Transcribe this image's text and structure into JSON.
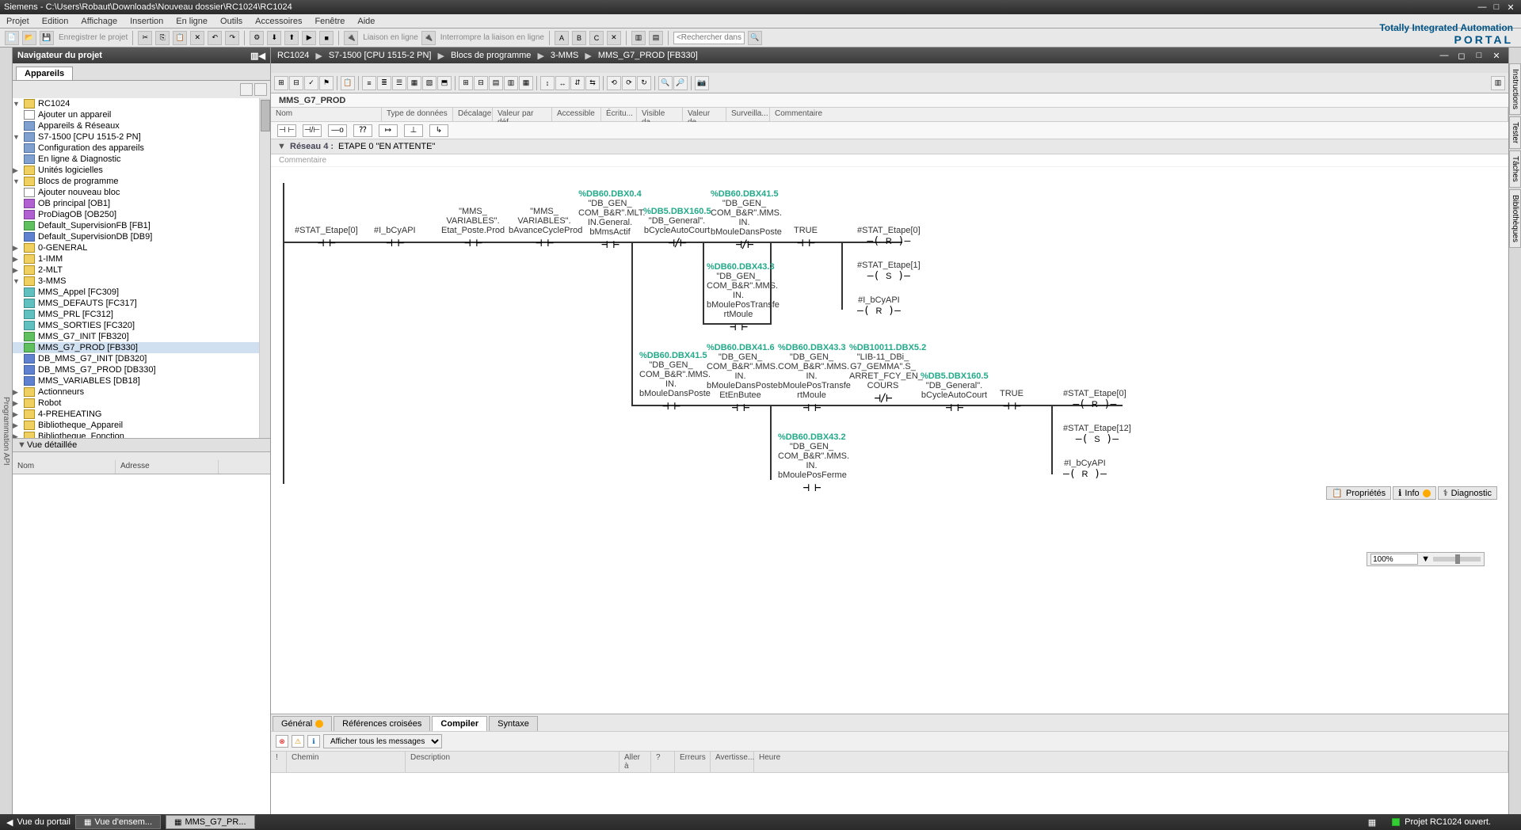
{
  "title": "Siemens  -  C:\\Users\\Robaut\\Downloads\\Nouveau dossier\\RC1024\\RC1024",
  "menus": [
    "Projet",
    "Edition",
    "Affichage",
    "Insertion",
    "En ligne",
    "Outils",
    "Accessoires",
    "Fenêtre",
    "Aide"
  ],
  "brand": {
    "line1": "Totally Integrated Automation",
    "line2": "PORTAL"
  },
  "toolbar": {
    "save": "Enregistrer le projet",
    "online": "Liaison en ligne",
    "offline": "Interrompre la liaison en ligne",
    "search_ph": "<Rechercher dans le"
  },
  "nav": {
    "title": "Navigateur du projet",
    "tab": "Appareils",
    "tree": [
      {
        "l": 0,
        "exp": "▼",
        "ic": "prj",
        "t": "RC1024"
      },
      {
        "l": 1,
        "exp": "",
        "ic": "add",
        "t": "Ajouter un appareil"
      },
      {
        "l": 1,
        "exp": "",
        "ic": "dev",
        "t": "Appareils & Réseaux"
      },
      {
        "l": 1,
        "exp": "▼",
        "ic": "dev",
        "t": "S7-1500 [CPU 1515-2 PN]"
      },
      {
        "l": 2,
        "exp": "",
        "ic": "dev",
        "t": "Configuration des appareils"
      },
      {
        "l": 2,
        "exp": "",
        "ic": "dev",
        "t": "En ligne & Diagnostic"
      },
      {
        "l": 2,
        "exp": "▶",
        "ic": "fld",
        "t": "Unités logicielles"
      },
      {
        "l": 2,
        "exp": "▼",
        "ic": "fld",
        "t": "Blocs de programme"
      },
      {
        "l": 3,
        "exp": "",
        "ic": "add",
        "t": "Ajouter nouveau bloc"
      },
      {
        "l": 3,
        "exp": "",
        "ic": "ob",
        "t": "OB principal [OB1]"
      },
      {
        "l": 3,
        "exp": "",
        "ic": "ob",
        "t": "ProDiagOB [OB250]"
      },
      {
        "l": 3,
        "exp": "",
        "ic": "fb",
        "t": "Default_SupervisionFB [FB1]"
      },
      {
        "l": 3,
        "exp": "",
        "ic": "db",
        "t": "Default_SupervisionDB [DB9]"
      },
      {
        "l": 3,
        "exp": "▶",
        "ic": "fld",
        "t": "0-GENERAL"
      },
      {
        "l": 3,
        "exp": "▶",
        "ic": "fld",
        "t": "1-IMM"
      },
      {
        "l": 3,
        "exp": "▶",
        "ic": "fld",
        "t": "2-MLT"
      },
      {
        "l": 3,
        "exp": "▼",
        "ic": "fld",
        "t": "3-MMS"
      },
      {
        "l": 4,
        "exp": "",
        "ic": "fc",
        "t": "MMS_Appel [FC309]"
      },
      {
        "l": 4,
        "exp": "",
        "ic": "fc",
        "t": "MMS_DEFAUTS [FC317]"
      },
      {
        "l": 4,
        "exp": "",
        "ic": "fc",
        "t": "MMS_PRL [FC312]"
      },
      {
        "l": 4,
        "exp": "",
        "ic": "fc",
        "t": "MMS_SORTIES [FC320]"
      },
      {
        "l": 4,
        "exp": "",
        "ic": "fb",
        "t": "MMS_G7_INIT [FB320]"
      },
      {
        "l": 4,
        "exp": "",
        "ic": "fb",
        "t": "MMS_G7_PROD [FB330]",
        "sel": true
      },
      {
        "l": 4,
        "exp": "",
        "ic": "db",
        "t": "DB_MMS_G7_INIT [DB320]"
      },
      {
        "l": 4,
        "exp": "",
        "ic": "db",
        "t": "DB_MMS_G7_PROD [DB330]"
      },
      {
        "l": 4,
        "exp": "",
        "ic": "db",
        "t": "MMS_VARIABLES [DB18]"
      },
      {
        "l": 3,
        "exp": "▶",
        "ic": "fld",
        "t": "Actionneurs"
      },
      {
        "l": 3,
        "exp": "▶",
        "ic": "fld",
        "t": "Robot"
      },
      {
        "l": 3,
        "exp": "▶",
        "ic": "fld",
        "t": "4-PREHEATING"
      },
      {
        "l": 3,
        "exp": "▶",
        "ic": "fld",
        "t": "Bibliotheque_Appareil"
      },
      {
        "l": 3,
        "exp": "▶",
        "ic": "fld",
        "t": "Bibliotheque_Fonction"
      }
    ],
    "detail": "Vue détaillée",
    "detail_cols": [
      "Nom",
      "Adresse"
    ]
  },
  "breadcrumb": [
    "RC1024",
    "S7-1500 [CPU 1515-2 PN]",
    "Blocs de programme",
    "3-MMS",
    "MMS_G7_PROD [FB330]"
  ],
  "fb_title": "MMS_G7_PROD",
  "iface_cols": [
    "Nom",
    "Type de données",
    "Décalage",
    "Valeur par déf.",
    "Accessible ...",
    "Écritu...",
    "Visible da...",
    "Valeur de ...",
    "Surveilla...",
    "Commentaire"
  ],
  "sym_row": [
    "⊣ ⊢",
    "⊣/⊢",
    "—o",
    "⁇",
    "↦",
    "⊥",
    "↳"
  ],
  "network": {
    "hdr": "Réseau 4 :",
    "title": "ETAPE 0 \"EN ATTENTE\"",
    "comment": "Commentaire"
  },
  "ladder": {
    "c1": {
      "l": "#STAT_Etape[0]"
    },
    "c2": {
      "l": "#I_bCyAPI"
    },
    "c3": {
      "l": "\"MMS_\nVARIABLES\".\nEtat_Poste.Prod"
    },
    "c4": {
      "l": "\"MMS_\nVARIABLES\".\nbAvanceCycleProd"
    },
    "c5": {
      "a": "%DB60.DBX0.4",
      "l": "\"DB_GEN_\nCOM_B&R\".MLT.\nIN.General.\nbMmsActif"
    },
    "c6": {
      "a": "%DB5.DBX160.5",
      "l": "\"DB_General\".\nbCycleAutoCourt"
    },
    "c7": {
      "a": "%DB60.DBX41.5",
      "l": "\"DB_GEN_\nCOM_B&R\".MMS.\nIN.\nbMouleDansPoste"
    },
    "c8": {
      "l": "TRUE"
    },
    "o1": {
      "l": "#STAT_Etape[0]",
      "t": "R"
    },
    "c9": {
      "a": "%DB60.DBX43.3",
      "l": "\"DB_GEN_\nCOM_B&R\".MMS.\nIN.\nbMoulePosTransfe\nrtMoule"
    },
    "o2": {
      "l": "#STAT_Etape[1]",
      "t": "S"
    },
    "o3": {
      "l": "#I_bCyAPI",
      "t": "R"
    },
    "c10": {
      "a": "%DB60.DBX41.5",
      "l": "\"DB_GEN_\nCOM_B&R\".MMS.\nIN.\nbMouleDansPoste"
    },
    "c11": {
      "a": "%DB60.DBX41.6",
      "l": "\"DB_GEN_\nCOM_B&R\".MMS.\nIN.\nbMouleDansPoste\nEtEnButee"
    },
    "c12": {
      "a": "%DB60.DBX43.3",
      "l": "\"DB_GEN_\nCOM_B&R\".MMS.\nIN.\nbMoulePosTransfe\nrtMoule"
    },
    "c13": {
      "a": "%DB10011.DBX5.2",
      "l": "\"LIB-11_DBi_\nG7_GEMMA\".S_\nARRET_FCY_EN_\nCOURS"
    },
    "c14": {
      "a": "%DB5.DBX160.5",
      "l": "\"DB_General\".\nbCycleAutoCourt"
    },
    "c15": {
      "l": "TRUE"
    },
    "o4": {
      "l": "#STAT_Etape[0]",
      "t": "R"
    },
    "c16": {
      "a": "%DB60.DBX43.2",
      "l": "\"DB_GEN_\nCOM_B&R\".MMS.\nIN.\nbMoulePosFerme"
    },
    "o5": {
      "l": "#STAT_Etape[12]",
      "t": "S"
    },
    "o6": {
      "l": "#I_bCyAPI",
      "t": "R"
    }
  },
  "bottom_tabs": [
    "Général",
    "Références croisées",
    "Compiler",
    "Syntaxe"
  ],
  "msg_filter": "Afficher tous les messages",
  "msg_cols": [
    "!",
    "Chemin",
    "Description",
    "Aller à",
    "?",
    "Erreurs",
    "Avertisse...",
    "Heure"
  ],
  "right_tabs": [
    "Instructions",
    "Tester",
    "Tâches",
    "Bibliothèques"
  ],
  "inspect": [
    "Propriétés",
    "Info",
    "Diagnostic"
  ],
  "zoom": "100%",
  "status": {
    "portal": "Vue du portail",
    "t1": "Vue d'ensem...",
    "t2": "MMS_G7_PR...",
    "msg": "Projet RC1024 ouvert."
  }
}
